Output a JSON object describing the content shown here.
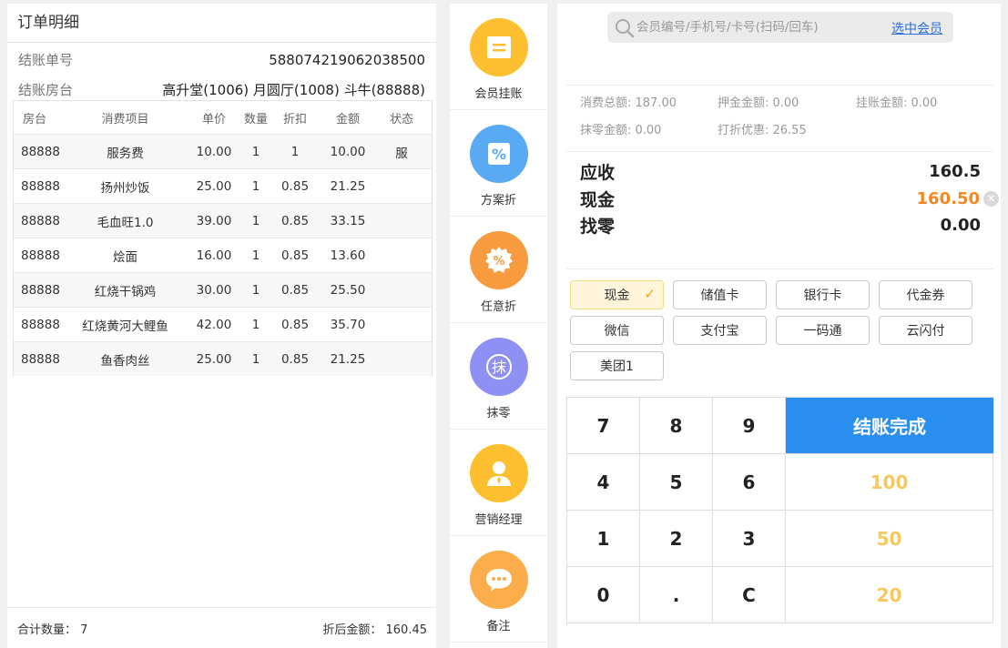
{
  "order": {
    "title": "订单明细",
    "checkout_no_label": "结账单号",
    "checkout_no": "588074219062038500",
    "rooms_label": "结账房台",
    "rooms": "高升堂(1006) 月圆厅(1008) 斗牛(88888)",
    "columns": [
      "房台",
      "消费项目",
      "单价",
      "数量",
      "折扣",
      "金额",
      "状态"
    ],
    "rows": [
      {
        "room": "88888",
        "item": "服务费",
        "price": "10.00",
        "qty": "1",
        "disc": "1",
        "amount": "10.00",
        "status": "服"
      },
      {
        "room": "88888",
        "item": "扬州炒饭",
        "price": "25.00",
        "qty": "1",
        "disc": "0.85",
        "amount": "21.25",
        "status": ""
      },
      {
        "room": "88888",
        "item": "毛血旺1.0",
        "price": "39.00",
        "qty": "1",
        "disc": "0.85",
        "amount": "33.15",
        "status": ""
      },
      {
        "room": "88888",
        "item": "烩面",
        "price": "16.00",
        "qty": "1",
        "disc": "0.85",
        "amount": "13.60",
        "status": ""
      },
      {
        "room": "88888",
        "item": "红烧干锅鸡",
        "price": "30.00",
        "qty": "1",
        "disc": "0.85",
        "amount": "25.50",
        "status": ""
      },
      {
        "room": "88888",
        "item": "红烧黄河大鲤鱼",
        "price": "42.00",
        "qty": "1",
        "disc": "0.85",
        "amount": "35.70",
        "status": ""
      },
      {
        "room": "88888",
        "item": "鱼香肉丝",
        "price": "25.00",
        "qty": "1",
        "disc": "0.85",
        "amount": "21.25",
        "status": ""
      }
    ],
    "total_qty_label": "合计数量：",
    "total_qty": "7",
    "after_disc_label": "折后金额：",
    "after_disc": "160.45"
  },
  "actions": [
    {
      "label": "会员挂账",
      "icon": "member-charge-icon",
      "color": "#fdbf2f"
    },
    {
      "label": "方案折",
      "icon": "percent-plan-icon",
      "color": "#59aaf2"
    },
    {
      "label": "任意折",
      "icon": "custom-discount-icon",
      "color": "#f89a3e"
    },
    {
      "label": "抹零",
      "icon": "round-off-icon",
      "color": "#8f90f3"
    },
    {
      "label": "营销经理",
      "icon": "manager-icon",
      "color": "#fdbf2f"
    },
    {
      "label": "备注",
      "icon": "note-icon",
      "color": "#fbad4b"
    }
  ],
  "search": {
    "placeholder": "会员编号/手机号/卡号(扫码/回车)",
    "select_member": "选中会员"
  },
  "summary": {
    "total_consume": "消费总额: 187.00",
    "deposit": "押金金额: 0.00",
    "on_account": "挂账金额: 0.00",
    "round_off": "抹零金额: 0.00",
    "discount": "打折优惠: 26.55"
  },
  "settle": {
    "due_label": "应收",
    "due": "160.5",
    "cash_label": "现金",
    "cash": "160.50",
    "change_label": "找零",
    "change": "0.00"
  },
  "payments": [
    "现金",
    "储值卡",
    "银行卡",
    "代金券",
    "微信",
    "支付宝",
    "一码通",
    "云闪付",
    "美团1"
  ],
  "selected_payment": "现金",
  "keypad": {
    "keys": [
      "7",
      "8",
      "9",
      "4",
      "5",
      "6",
      "1",
      "2",
      "3",
      "0",
      ".",
      "C"
    ],
    "confirm": "结账完成",
    "quick": [
      "100",
      "50",
      "20"
    ]
  }
}
